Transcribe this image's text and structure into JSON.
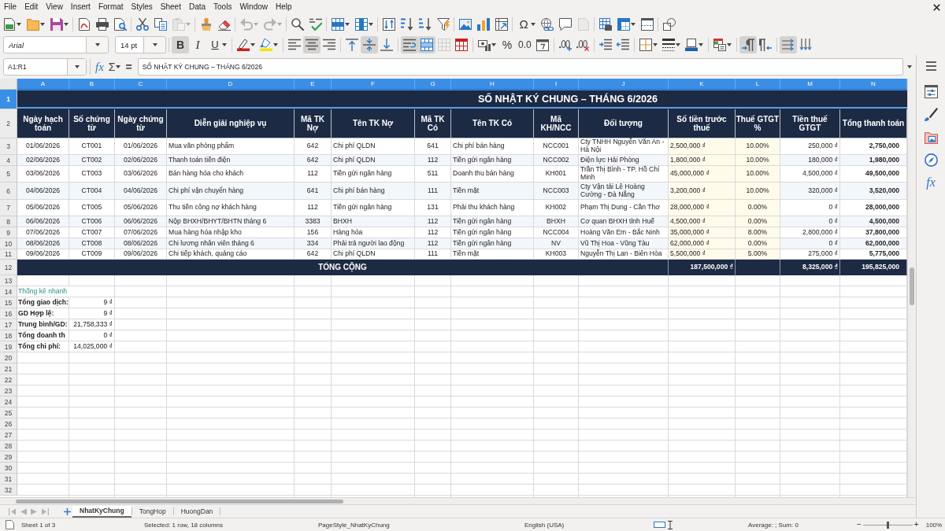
{
  "menu_bar": {
    "items": [
      "File",
      "Edit",
      "View",
      "Insert",
      "Format",
      "Styles",
      "Sheet",
      "Data",
      "Tools",
      "Window",
      "Help"
    ]
  },
  "standard_toolbar": {
    "groups": [
      [
        {
          "kind": "new",
          "dropdown": true,
          "pressed": false,
          "disabled": false
        },
        {
          "kind": "open",
          "dropdown": true,
          "pressed": false,
          "disabled": false
        },
        {
          "kind": "save",
          "dropdown": true,
          "pressed": false,
          "disabled": false
        }
      ],
      [
        {
          "kind": "export-pdf",
          "dropdown": false,
          "pressed": false,
          "disabled": false
        },
        {
          "kind": "print",
          "dropdown": false,
          "pressed": false,
          "disabled": false
        },
        {
          "kind": "print-preview",
          "dropdown": false,
          "pressed": false,
          "disabled": false
        }
      ],
      [
        {
          "kind": "cut",
          "dropdown": false,
          "pressed": false,
          "disabled": false
        },
        {
          "kind": "copy",
          "dropdown": false,
          "pressed": false,
          "disabled": false
        },
        {
          "kind": "paste",
          "dropdown": true,
          "pressed": false,
          "disabled": true
        }
      ],
      [
        {
          "kind": "clone-formatting",
          "dropdown": false,
          "pressed": false,
          "disabled": false
        },
        {
          "kind": "clear-formatting",
          "dropdown": false,
          "pressed": false,
          "disabled": false
        }
      ],
      [
        {
          "kind": "undo",
          "dropdown": true,
          "pressed": false,
          "disabled": true
        },
        {
          "kind": "redo",
          "dropdown": true,
          "pressed": false,
          "disabled": true
        }
      ],
      [
        {
          "kind": "find-replace",
          "dropdown": false,
          "pressed": false,
          "disabled": false
        },
        {
          "kind": "spelling",
          "dropdown": false,
          "pressed": false,
          "disabled": false
        }
      ],
      [
        {
          "kind": "rows",
          "dropdown": true,
          "pressed": false,
          "disabled": false
        },
        {
          "kind": "columns",
          "dropdown": true,
          "pressed": false,
          "disabled": false
        }
      ],
      [
        {
          "kind": "sort",
          "dropdown": false,
          "pressed": false,
          "disabled": false
        },
        {
          "kind": "sort-ascending",
          "dropdown": false,
          "pressed": false,
          "disabled": false
        },
        {
          "kind": "sort-descending",
          "dropdown": false,
          "pressed": false,
          "disabled": false
        },
        {
          "kind": "autofilter",
          "dropdown": false,
          "pressed": false,
          "disabled": false
        }
      ],
      [
        {
          "kind": "insert-image",
          "dropdown": false,
          "pressed": false,
          "disabled": false
        },
        {
          "kind": "insert-chart",
          "dropdown": false,
          "pressed": false,
          "disabled": false
        },
        {
          "kind": "pivot-table",
          "dropdown": false,
          "pressed": false,
          "disabled": false
        }
      ],
      [
        {
          "kind": "special-character",
          "label": "Ω",
          "dropdown": true,
          "pressed": false,
          "disabled": false
        },
        {
          "kind": "hyperlink",
          "dropdown": false,
          "pressed": false,
          "disabled": false
        },
        {
          "kind": "comment",
          "dropdown": false,
          "pressed": false,
          "disabled": false
        },
        {
          "kind": "header-footer",
          "dropdown": false,
          "pressed": false,
          "disabled": true
        }
      ],
      [
        {
          "kind": "print-area",
          "dropdown": false,
          "pressed": false,
          "disabled": false
        },
        {
          "kind": "freeze",
          "dropdown": true,
          "pressed": false,
          "disabled": false
        },
        {
          "kind": "split-window",
          "dropdown": false,
          "pressed": false,
          "disabled": false
        }
      ],
      [
        {
          "kind": "shapes",
          "dropdown": false,
          "pressed": false,
          "disabled": false
        }
      ]
    ]
  },
  "formatting_toolbar": {
    "font_name": {
      "value": "Arial",
      "substituted": true
    },
    "font_size": {
      "value": "14 pt",
      "substituted": false
    },
    "groups": [
      [
        {
          "kind": "bold",
          "label": "B",
          "dropdown": false,
          "pressed": true,
          "disabled": false
        },
        {
          "kind": "italic",
          "label": "I",
          "dropdown": false,
          "pressed": false,
          "disabled": false
        },
        {
          "kind": "underline",
          "label": "U",
          "dropdown": true,
          "pressed": false,
          "disabled": false
        }
      ],
      [
        {
          "kind": "font-color",
          "dropdown": true,
          "pressed": false,
          "disabled": false
        },
        {
          "kind": "highlight",
          "dropdown": true,
          "pressed": false,
          "disabled": false
        }
      ],
      [
        {
          "kind": "align-left",
          "dropdown": false,
          "pressed": false,
          "disabled": false
        },
        {
          "kind": "align-center",
          "dropdown": false,
          "pressed": true,
          "disabled": false
        },
        {
          "kind": "align-right",
          "dropdown": false,
          "pressed": false,
          "disabled": false
        }
      ],
      [
        {
          "kind": "align-top",
          "dropdown": false,
          "pressed": false,
          "disabled": false
        },
        {
          "kind": "align-middle",
          "dropdown": false,
          "pressed": true,
          "disabled": false
        },
        {
          "kind": "align-bottom",
          "dropdown": false,
          "pressed": false,
          "disabled": false
        }
      ],
      [
        {
          "kind": "wrap-text",
          "dropdown": false,
          "pressed": true,
          "disabled": false
        },
        {
          "kind": "merge-center",
          "dropdown": false,
          "pressed": true,
          "disabled": false
        },
        {
          "kind": "merge-cells",
          "dropdown": false,
          "pressed": false,
          "disabled": true
        },
        {
          "kind": "unmerge-cells",
          "dropdown": false,
          "pressed": false,
          "disabled": false
        }
      ],
      [
        {
          "kind": "currency",
          "dropdown": true,
          "pressed": false,
          "disabled": false
        },
        {
          "kind": "percent",
          "label": "%",
          "dropdown": false,
          "pressed": false,
          "disabled": false
        },
        {
          "kind": "number-format",
          "label": "0.0",
          "dropdown": false,
          "pressed": false,
          "disabled": false
        },
        {
          "kind": "date-format",
          "dropdown": false,
          "pressed": false,
          "disabled": false
        }
      ],
      [
        {
          "kind": "add-decimal",
          "dropdown": false,
          "pressed": false,
          "disabled": false
        },
        {
          "kind": "delete-decimal",
          "dropdown": false,
          "pressed": false,
          "disabled": false
        }
      ],
      [
        {
          "kind": "increase-indent",
          "dropdown": false,
          "pressed": false,
          "disabled": false
        },
        {
          "kind": "decrease-indent",
          "dropdown": false,
          "pressed": false,
          "disabled": false
        }
      ],
      [
        {
          "kind": "borders",
          "dropdown": true,
          "pressed": false,
          "disabled": false
        },
        {
          "kind": "border-style",
          "dropdown": true,
          "pressed": false,
          "disabled": false
        },
        {
          "kind": "border-color",
          "dropdown": true,
          "pressed": false,
          "disabled": false
        }
      ],
      [
        {
          "kind": "conditional-format",
          "dropdown": true,
          "pressed": false,
          "disabled": false
        }
      ],
      [
        {
          "kind": "left-to-right",
          "dropdown": false,
          "pressed": true,
          "disabled": false
        },
        {
          "kind": "right-to-left",
          "dropdown": false,
          "pressed": false,
          "disabled": false
        }
      ],
      [
        {
          "kind": "text-direction",
          "dropdown": false,
          "pressed": true,
          "disabled": false
        },
        {
          "kind": "vertical-text",
          "dropdown": false,
          "pressed": false,
          "disabled": false
        }
      ]
    ]
  },
  "formula_bar": {
    "name_box": "A1:R1",
    "buttons": [
      {
        "kind": "function-wizard",
        "label": "fx",
        "dropdown": false
      },
      {
        "kind": "sum",
        "label": "Σ",
        "dropdown": true
      },
      {
        "kind": "formula",
        "label": "=",
        "dropdown": false
      }
    ],
    "input": "SỐ NHẬT KÝ CHUNG – THÁNG 6/2026"
  },
  "sidebar": {
    "buttons": [
      {
        "kind": "properties"
      },
      {
        "kind": "styles"
      },
      {
        "kind": "gallery"
      },
      {
        "kind": "navigator"
      },
      {
        "kind": "functions",
        "label": "fx"
      }
    ]
  },
  "sheet": {
    "column_headers": [
      {
        "label": "A",
        "selected": true
      },
      {
        "label": "B",
        "selected": true
      },
      {
        "label": "C",
        "selected": true
      },
      {
        "label": "D",
        "selected": true
      },
      {
        "label": "E",
        "selected": true
      },
      {
        "label": "F",
        "selected": true
      },
      {
        "label": "G",
        "selected": true
      },
      {
        "label": "H",
        "selected": true
      },
      {
        "label": "I",
        "selected": true
      },
      {
        "label": "J",
        "selected": true
      },
      {
        "label": "K",
        "selected": true
      },
      {
        "label": "L",
        "selected": true
      },
      {
        "label": "M",
        "selected": true
      },
      {
        "label": "N",
        "selected": true
      }
    ],
    "row_headers": [
      {
        "label": "1",
        "selected": true
      },
      {
        "label": "2",
        "selected": false
      },
      {
        "label": "3",
        "selected": false
      },
      {
        "label": "4",
        "selected": false
      },
      {
        "label": "5",
        "selected": false
      },
      {
        "label": "6",
        "selected": false
      },
      {
        "label": "7",
        "selected": false
      },
      {
        "label": "8",
        "selected": false
      },
      {
        "label": "9",
        "selected": false
      },
      {
        "label": "10",
        "selected": false
      },
      {
        "label": "11",
        "selected": false
      },
      {
        "label": "12",
        "selected": false
      },
      {
        "label": "13",
        "selected": false
      },
      {
        "label": "14",
        "selected": false
      },
      {
        "label": "15",
        "selected": false
      },
      {
        "label": "16",
        "selected": false
      },
      {
        "label": "17",
        "selected": false
      },
      {
        "label": "18",
        "selected": false
      },
      {
        "label": "19",
        "selected": false
      },
      {
        "label": "20",
        "selected": false
      },
      {
        "label": "21",
        "selected": false
      },
      {
        "label": "22",
        "selected": false
      },
      {
        "label": "23",
        "selected": false
      },
      {
        "label": "24",
        "selected": false
      },
      {
        "label": "25",
        "selected": false
      },
      {
        "label": "26",
        "selected": false
      },
      {
        "label": "27",
        "selected": false
      },
      {
        "label": "28",
        "selected": false
      },
      {
        "label": "29",
        "selected": false
      },
      {
        "label": "30",
        "selected": false
      },
      {
        "label": "31",
        "selected": false
      },
      {
        "label": "32",
        "selected": false
      }
    ],
    "title": "SỐ NHẬT KÝ CHUNG – THÁNG 6/2026",
    "header_row": [
      "Ngày hạch toán",
      "Số chứng từ",
      "Ngày chứng từ",
      "Diễn giải nghiệp vụ",
      "Mã TK Nợ",
      "Tên TK Nợ",
      "Mã TK Có",
      "Tên TK Có",
      "Mã KH/NCC",
      "Đối tượng",
      "Số tiền trước thuế",
      "Thuế GTGT %",
      "Tiền thuế GTGT",
      "Tổng thanh toán"
    ],
    "rows": [
      [
        "01/06/2026",
        "CT001",
        "01/06/2026",
        "Mua văn phòng phẩm",
        "642",
        "Chi phí QLDN",
        "641",
        "Chi phí bán hàng",
        "NCC001",
        "Cty TNHH Nguyễn Văn An - Hà Nội",
        "2,500,000 ₫",
        "10.00%",
        "250,000 ₫",
        "2,750,000"
      ],
      [
        "02/06/2026",
        "CT002",
        "02/06/2026",
        "Thanh toán tiền điện",
        "642",
        "Chi phí QLDN",
        "112",
        "Tiền gửi ngân hàng",
        "NCC002",
        "Điện lực Hải Phòng",
        "1,800,000 ₫",
        "10.00%",
        "180,000 ₫",
        "1,980,000"
      ],
      [
        "03/06/2026",
        "CT003",
        "03/06/2026",
        "Bán hàng hóa cho khách",
        "112",
        "Tiền gửi ngân hàng",
        "511",
        "Doanh thu bán hàng",
        "KH001",
        "Trần Thị Bình - TP. Hồ Chí Minh",
        "45,000,000 ₫",
        "10.00%",
        "4,500,000 ₫",
        "49,500,000"
      ],
      [
        "04/06/2026",
        "CT004",
        "04/06/2026",
        "Chi phí vận chuyển hàng",
        "641",
        "Chi phí bán hàng",
        "111",
        "Tiền mặt",
        "NCC003",
        "Cty Vận tải Lê Hoàng Cường - Đà Nẵng",
        "3,200,000 ₫",
        "10.00%",
        "320,000 ₫",
        "3,520,000"
      ],
      [
        "05/06/2026",
        "CT005",
        "05/06/2026",
        "Thu tiền công nợ khách hàng",
        "112",
        "Tiền gửi ngân hàng",
        "131",
        "Phải thu khách hàng",
        "KH002",
        "Phạm Thị Dung - Cần Thơ",
        "28,000,000 ₫",
        "0.00%",
        "0 ₫",
        "28,000,000"
      ],
      [
        "06/06/2026",
        "CT006",
        "06/06/2026",
        "Nộp BHXH/BHYT/BHTN tháng 6",
        "3383",
        "BHXH",
        "112",
        "Tiền gửi ngân hàng",
        "BHXH",
        "Cơ quan BHXH tỉnh Huế",
        "4,500,000 ₫",
        "0.00%",
        "0 ₫",
        "4,500,000"
      ],
      [
        "07/06/2026",
        "CT007",
        "07/06/2026",
        "Mua hàng hóa nhập kho",
        "156",
        "Hàng hóa",
        "112",
        "Tiền gửi ngân hàng",
        "NCC004",
        "Hoàng Văn Em - Bắc Ninh",
        "35,000,000 ₫",
        "8.00%",
        "2,800,000 ₫",
        "37,800,000"
      ],
      [
        "08/06/2026",
        "CT008",
        "08/06/2026",
        "Chi lương nhân viên tháng 6",
        "334",
        "Phải trả người lao động",
        "112",
        "Tiền gửi ngân hàng",
        "NV",
        "Vũ Thị Hoa - Vũng Tàu",
        "62,000,000 ₫",
        "0.00%",
        "0 ₫",
        "62,000,000"
      ],
      [
        "09/06/2026",
        "CT009",
        "09/06/2026",
        "Chi tiếp khách, quảng cáo",
        "642",
        "Chi phí QLDN",
        "111",
        "Tiền mặt",
        "KH003",
        "Nguyễn Thị Lan - Biên Hòa",
        "5,500,000 ₫",
        "5.00%",
        "275,000 ₫",
        "5,775,000"
      ]
    ],
    "total_row": {
      "label": "TỔNG CỘNG",
      "before_tax": "187,500,000 ₫",
      "vat": "8,325,000 ₫",
      "grand_total": "195,825,000"
    },
    "quick_stats": {
      "title": "Thống kê nhanh",
      "items": [
        {
          "label": "Tổng giao dịch:",
          "value": "9 ₫"
        },
        {
          "label": "GD Hợp lệ:",
          "value": "9 ₫"
        },
        {
          "label": "Trung bình/GD:",
          "value": "21,758,333 ₫"
        },
        {
          "label": "Tổng doanh th",
          "value": "0 ₫"
        },
        {
          "label": "Tổng chi phí:",
          "value": "14,025,000 ₫"
        }
      ]
    }
  },
  "sheet_tabs": {
    "navigation": [
      {
        "kind": "first",
        "disabled": true
      },
      {
        "kind": "previous",
        "disabled": true
      },
      {
        "kind": "next",
        "disabled": true
      },
      {
        "kind": "last",
        "disabled": true
      }
    ],
    "tabs": [
      {
        "label": "NhatKyChung",
        "selected": true
      },
      {
        "label": "TongHop",
        "selected": false
      },
      {
        "label": "HuongDan",
        "selected": false
      }
    ]
  },
  "status_bar": {
    "sheet": "Sheet 1 of 3",
    "selection": "Selected: 1 row, 18 columns",
    "page_style": "PageStyle_NhatKyChung",
    "language": "English (USA)",
    "summary": "Average: ; Sum: 0",
    "zoom": {
      "minus": "−",
      "plus": "+",
      "level": 0.5,
      "value": "100%"
    }
  }
}
